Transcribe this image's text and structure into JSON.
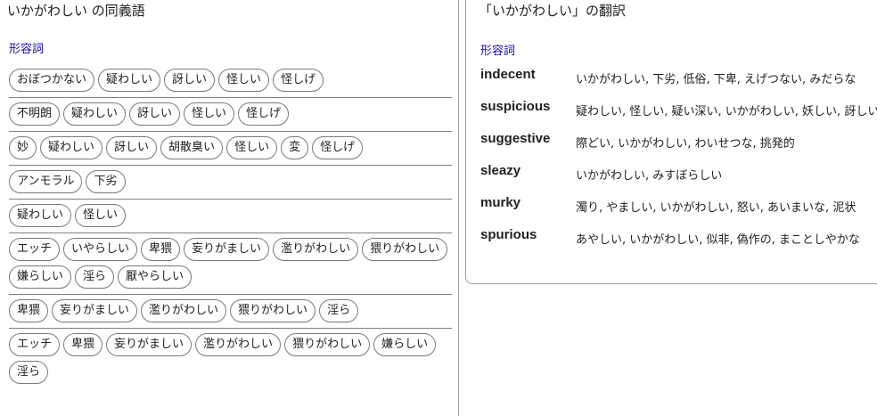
{
  "synonyms": {
    "title": "いかがわしい の同義語",
    "pos": "形容詞",
    "groups": [
      [
        "おぼつかない",
        "疑わしい",
        "訝しい",
        "怪しい",
        "怪しげ"
      ],
      [
        "不明朗",
        "疑わしい",
        "訝しい",
        "怪しい",
        "怪しげ"
      ],
      [
        "妙",
        "疑わしい",
        "訝しい",
        "胡散臭い",
        "怪しい",
        "変",
        "怪しげ"
      ],
      [
        "アンモラル",
        "下劣"
      ],
      [
        "疑わしい",
        "怪しい"
      ],
      [
        "エッチ",
        "いやらしい",
        "卑猥",
        "妄りがましい",
        "濫りがわしい",
        "猥りがわしい",
        "嫌らしい",
        "淫ら",
        "厭やらしい"
      ],
      [
        "卑猥",
        "妄りがましい",
        "濫りがわしい",
        "猥りがわしい",
        "淫ら"
      ],
      [
        "エッチ",
        "卑猥",
        "妄りがましい",
        "濫りがわしい",
        "猥りがわしい",
        "嫌らしい",
        "淫ら"
      ]
    ]
  },
  "translations": {
    "title": "「いかがわしい」の翻訳",
    "pos": "形容詞",
    "rows": [
      {
        "en": "indecent",
        "ja": "いかがわしい, 下劣, 低俗, 下卑, えげつない, みだらな"
      },
      {
        "en": "suspicious",
        "ja": "疑わしい, 怪しい, 疑い深い, いかがわしい, 妖しい, 訝しい"
      },
      {
        "en": "suggestive",
        "ja": "際どい, いかがわしい, わいせつな, 挑発的"
      },
      {
        "en": "sleazy",
        "ja": "いかがわしい, みすぼらしい"
      },
      {
        "en": "murky",
        "ja": "濁り, やましい, いかがわしい, 怒い, あいまいな, 泥状"
      },
      {
        "en": "spurious",
        "ja": "あやしい, いかがわしい, 似非, 偽作の, まことしやかな"
      }
    ]
  }
}
